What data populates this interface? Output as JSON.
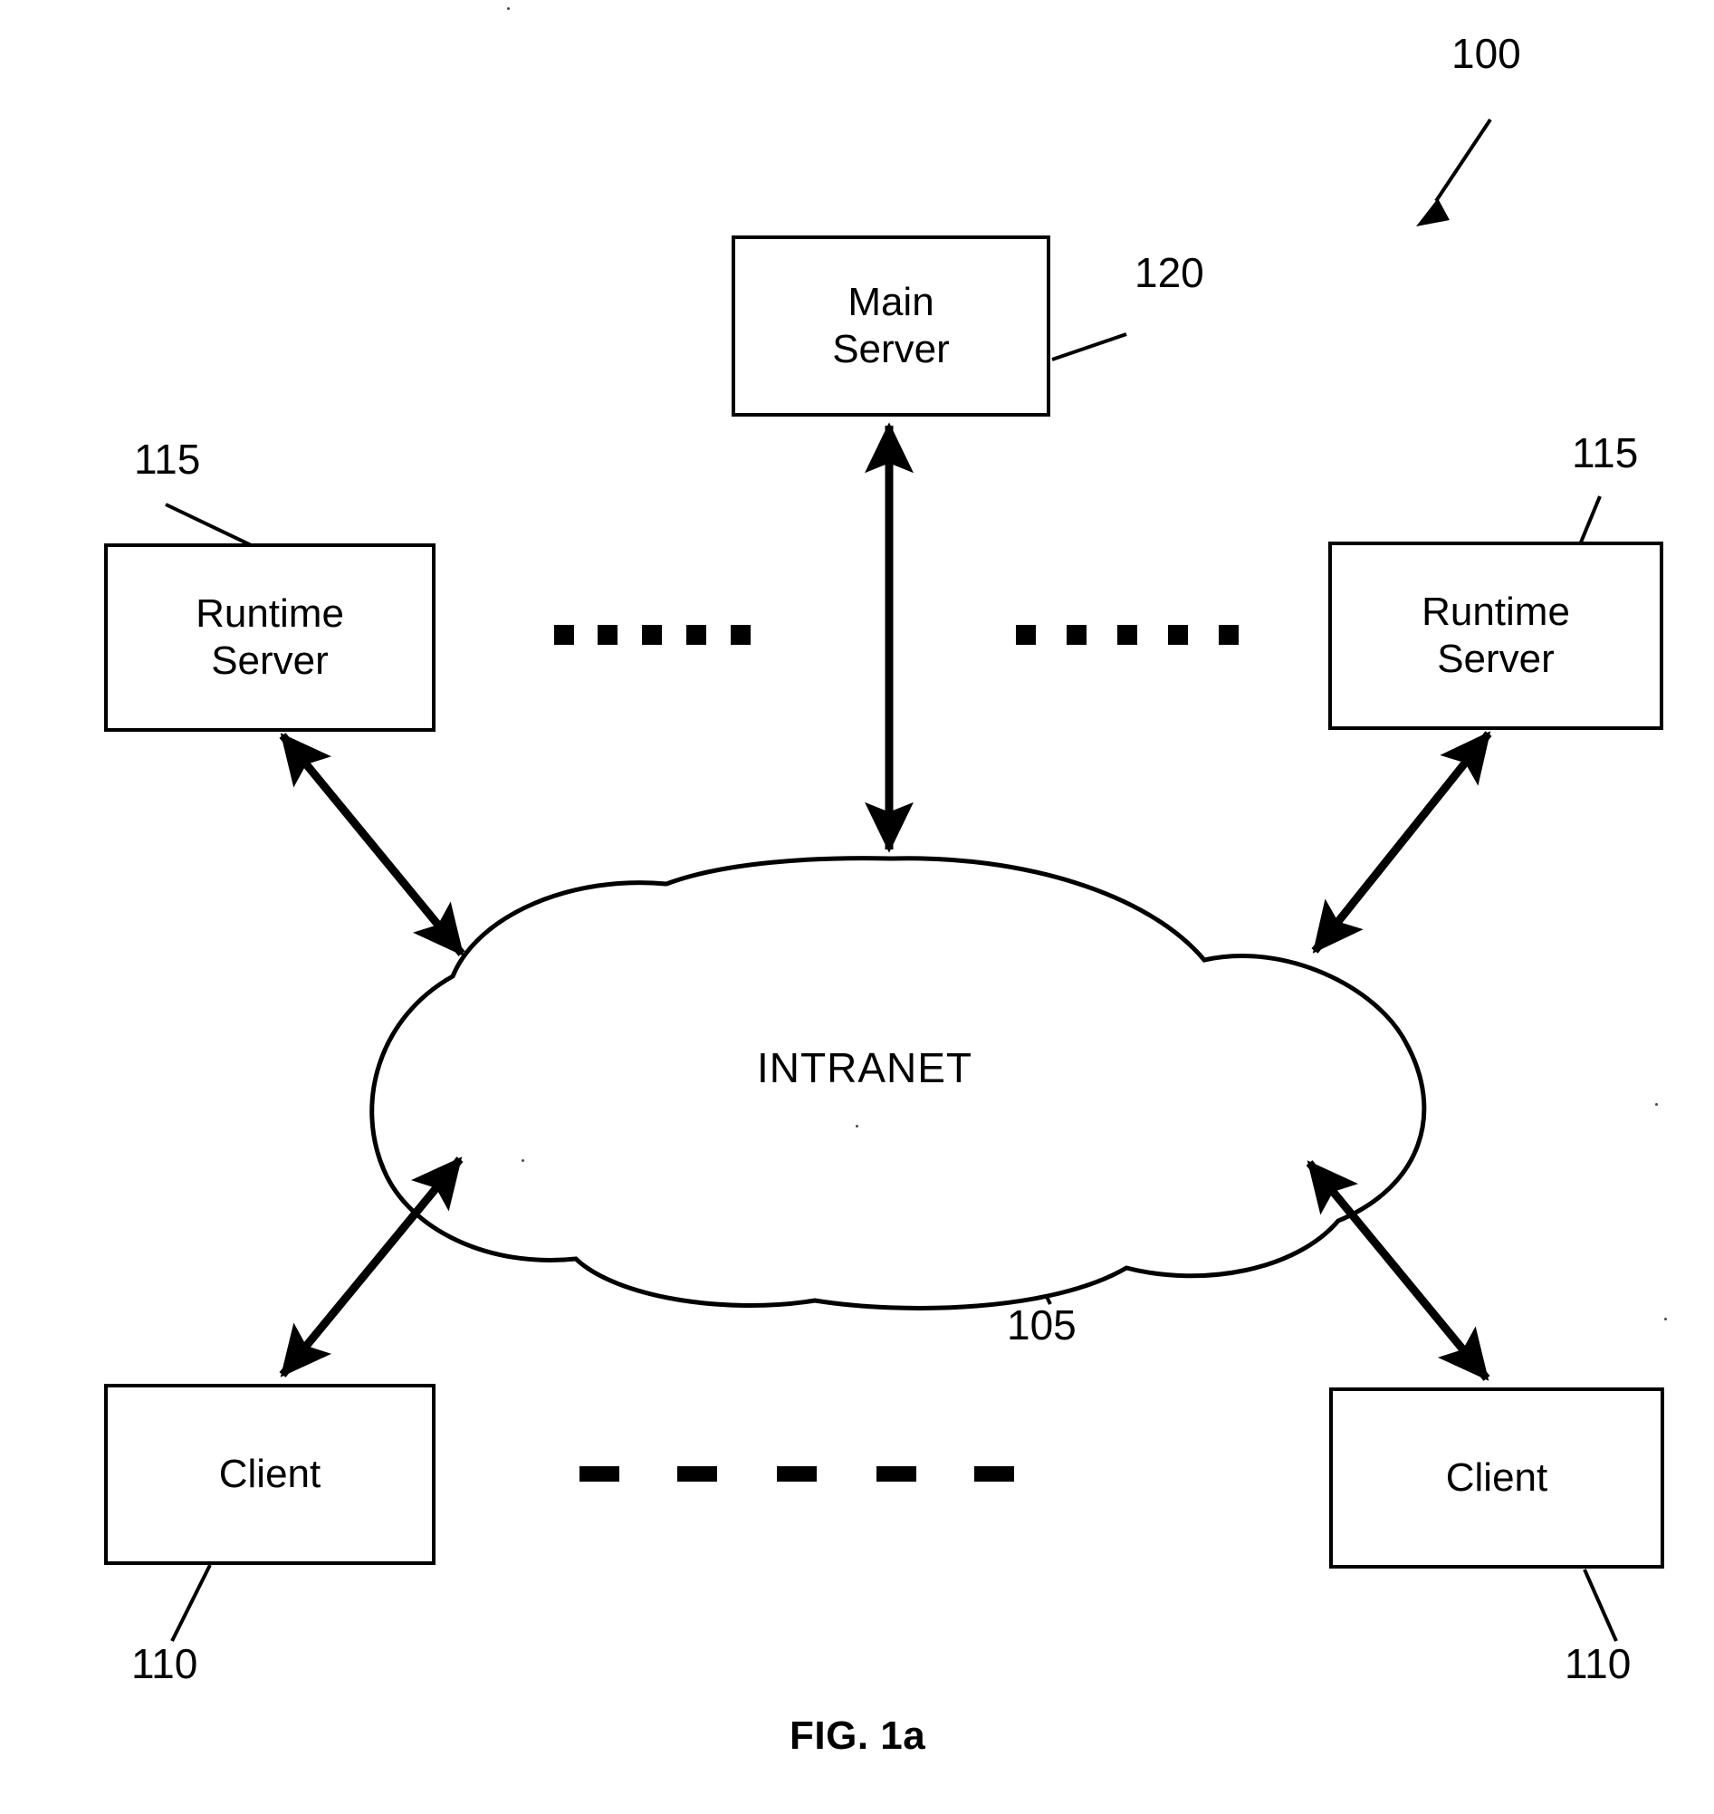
{
  "figure": {
    "caption": "FIG. 1a",
    "system_ref": "100"
  },
  "nodes": {
    "main_server": {
      "label": "Main\nServer",
      "ref": "120"
    },
    "runtime_server_left": {
      "label": "Runtime\nServer",
      "ref": "115"
    },
    "runtime_server_right": {
      "label": "Runtime\nServer",
      "ref": "115"
    },
    "client_left": {
      "label": "Client",
      "ref": "110"
    },
    "client_right": {
      "label": "Client",
      "ref": "110"
    },
    "network": {
      "label": "INTRANET",
      "ref": "105"
    }
  },
  "connections": [
    {
      "name": "main-server-to-intranet",
      "from": "Main Server",
      "to": "INTRANET",
      "style": "double-arrow"
    },
    {
      "name": "runtime-server-left-to-intranet",
      "from": "Runtime Server (left)",
      "to": "INTRANET",
      "style": "double-arrow"
    },
    {
      "name": "runtime-server-right-to-intranet",
      "from": "Runtime Server (right)",
      "to": "INTRANET",
      "style": "double-arrow"
    },
    {
      "name": "client-left-to-intranet",
      "from": "Client (left)",
      "to": "INTRANET",
      "style": "double-arrow"
    },
    {
      "name": "client-right-to-intranet",
      "from": "Client (right)",
      "to": "INTRANET",
      "style": "double-arrow"
    }
  ],
  "ellipsis": {
    "runtime_server_row_left_dots": 5,
    "runtime_server_row_right_dots": 5,
    "client_row_dashes": 5
  },
  "colors": {
    "stroke": "#000000",
    "background": "#ffffff"
  }
}
